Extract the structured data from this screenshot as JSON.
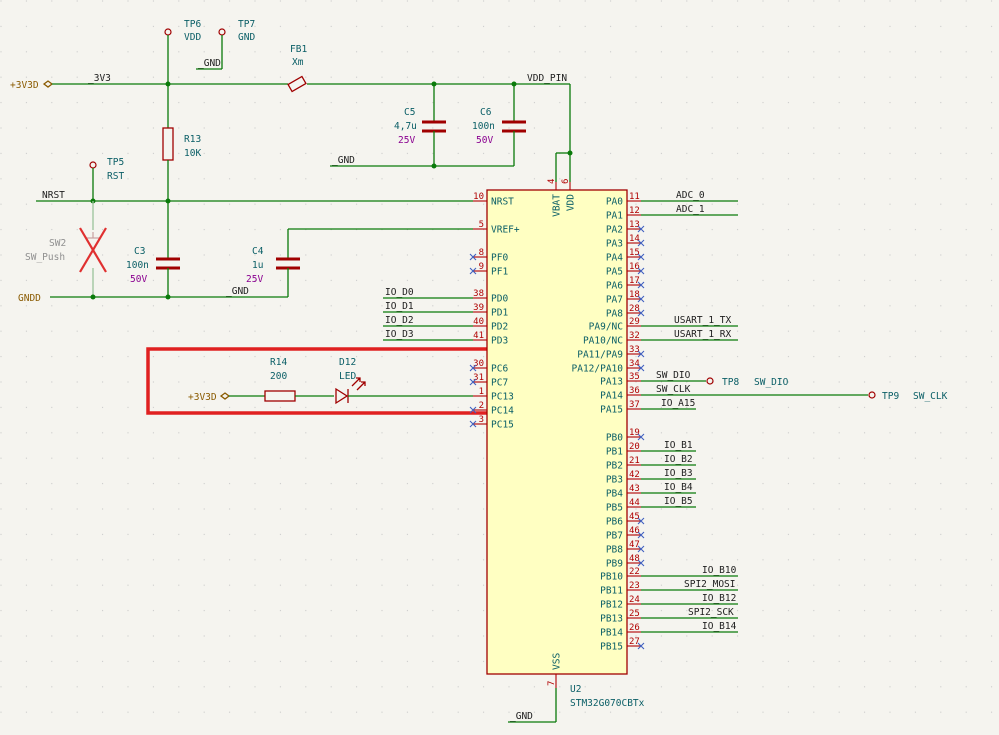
{
  "title": "",
  "power": {
    "v3v3d_top": "+3V3D",
    "v3v3d_led": "+3V3D",
    "gndd": "GNDD"
  },
  "nets": {
    "n3v3": "_3V3",
    "vdd_pin": "VDD_PIN",
    "gnd_tp7": "_GND",
    "gnd_caps": "_GND",
    "gnd_c4": "_GND",
    "gnd_u2": "_GND",
    "nrst": "NRST",
    "io_d0": "IO_D0",
    "io_d1": "IO_D1",
    "io_d2": "IO_D2",
    "io_d3": "IO_D3",
    "adc0": "ADC_0",
    "adc1": "ADC_1",
    "usart_tx": "USART_1_TX",
    "usart_rx": "USART_1_RX",
    "sw_dio": "SW_DIO",
    "sw_clk": "SW_CLK",
    "io_a15": "IO_A15",
    "io_b1": "IO_B1",
    "io_b2": "IO_B2",
    "io_b3": "IO_B3",
    "io_b4": "IO_B4",
    "io_b5": "IO_B5",
    "io_b10": "IO_B10",
    "spi_mosi": "SPI2_MOSI",
    "io_b12": "IO_B12",
    "spi_sck": "SPI2_SCK",
    "io_b14": "IO_B14"
  },
  "components": {
    "tp6": {
      "ref": "TP6",
      "val": "VDD"
    },
    "tp7": {
      "ref": "TP7",
      "val": "GND"
    },
    "tp5": {
      "ref": "TP5",
      "val": "RST"
    },
    "tp8": {
      "ref": "TP8",
      "val": "SW_DIO"
    },
    "tp9": {
      "ref": "TP9",
      "val": "SW_CLK"
    },
    "fb1": {
      "ref": "FB1",
      "val": "Xm"
    },
    "r13": {
      "ref": "R13",
      "val": "10K"
    },
    "r14": {
      "ref": "R14",
      "val": "200"
    },
    "d12": {
      "ref": "D12",
      "val": "LED"
    },
    "c3": {
      "ref": "C3",
      "val": "100n",
      "rating": "50V"
    },
    "c4": {
      "ref": "C4",
      "val": "1u",
      "rating": "25V"
    },
    "c5": {
      "ref": "C5",
      "val": "4,7u",
      "rating": "25V"
    },
    "c6": {
      "ref": "C6",
      "val": "100n",
      "rating": "50V"
    },
    "sw2": {
      "ref": "SW2",
      "val": "SW_Push"
    },
    "u2": {
      "ref": "U2",
      "val": "STM32G070CBTx"
    }
  },
  "ic_pins": {
    "left": [
      {
        "num": "10",
        "name": "NRST"
      },
      {
        "num": "5",
        "name": "VREF+"
      },
      {
        "num": "8",
        "name": "PF0"
      },
      {
        "num": "9",
        "name": "PF1"
      },
      {
        "num": "38",
        "name": "PD0"
      },
      {
        "num": "39",
        "name": "PD1"
      },
      {
        "num": "40",
        "name": "PD2"
      },
      {
        "num": "41",
        "name": "PD3"
      },
      {
        "num": "30",
        "name": "PC6"
      },
      {
        "num": "31",
        "name": "PC7"
      },
      {
        "num": "1",
        "name": "PC13"
      },
      {
        "num": "2",
        "name": "PC14"
      },
      {
        "num": "3",
        "name": "PC15"
      }
    ],
    "right": [
      {
        "num": "11",
        "name": "PA0"
      },
      {
        "num": "12",
        "name": "PA1"
      },
      {
        "num": "13",
        "name": "PA2"
      },
      {
        "num": "14",
        "name": "PA3"
      },
      {
        "num": "15",
        "name": "PA4"
      },
      {
        "num": "16",
        "name": "PA5"
      },
      {
        "num": "17",
        "name": "PA6"
      },
      {
        "num": "18",
        "name": "PA7"
      },
      {
        "num": "28",
        "name": "PA8"
      },
      {
        "num": "29",
        "name": "PA9/NC"
      },
      {
        "num": "32",
        "name": "PA10/NC"
      },
      {
        "num": "33",
        "name": "PA11/PA9"
      },
      {
        "num": "34",
        "name": "PA12/PA10"
      },
      {
        "num": "35",
        "name": "PA13"
      },
      {
        "num": "36",
        "name": "PA14"
      },
      {
        "num": "37",
        "name": "PA15"
      },
      {
        "num": "19",
        "name": "PB0"
      },
      {
        "num": "20",
        "name": "PB1"
      },
      {
        "num": "21",
        "name": "PB2"
      },
      {
        "num": "42",
        "name": "PB3"
      },
      {
        "num": "43",
        "name": "PB4"
      },
      {
        "num": "44",
        "name": "PB5"
      },
      {
        "num": "45",
        "name": "PB6"
      },
      {
        "num": "46",
        "name": "PB7"
      },
      {
        "num": "47",
        "name": "PB8"
      },
      {
        "num": "48",
        "name": "PB9"
      },
      {
        "num": "22",
        "name": "PB10"
      },
      {
        "num": "23",
        "name": "PB11"
      },
      {
        "num": "24",
        "name": "PB12"
      },
      {
        "num": "25",
        "name": "PB13"
      },
      {
        "num": "26",
        "name": "PB14"
      },
      {
        "num": "27",
        "name": "PB15"
      }
    ],
    "top": [
      {
        "num": "4",
        "name": "VBAT"
      },
      {
        "num": "6",
        "name": "VDD"
      }
    ],
    "bottom": [
      {
        "num": "7",
        "name": "VSS"
      }
    ]
  },
  "highlight_color": "#e02020"
}
